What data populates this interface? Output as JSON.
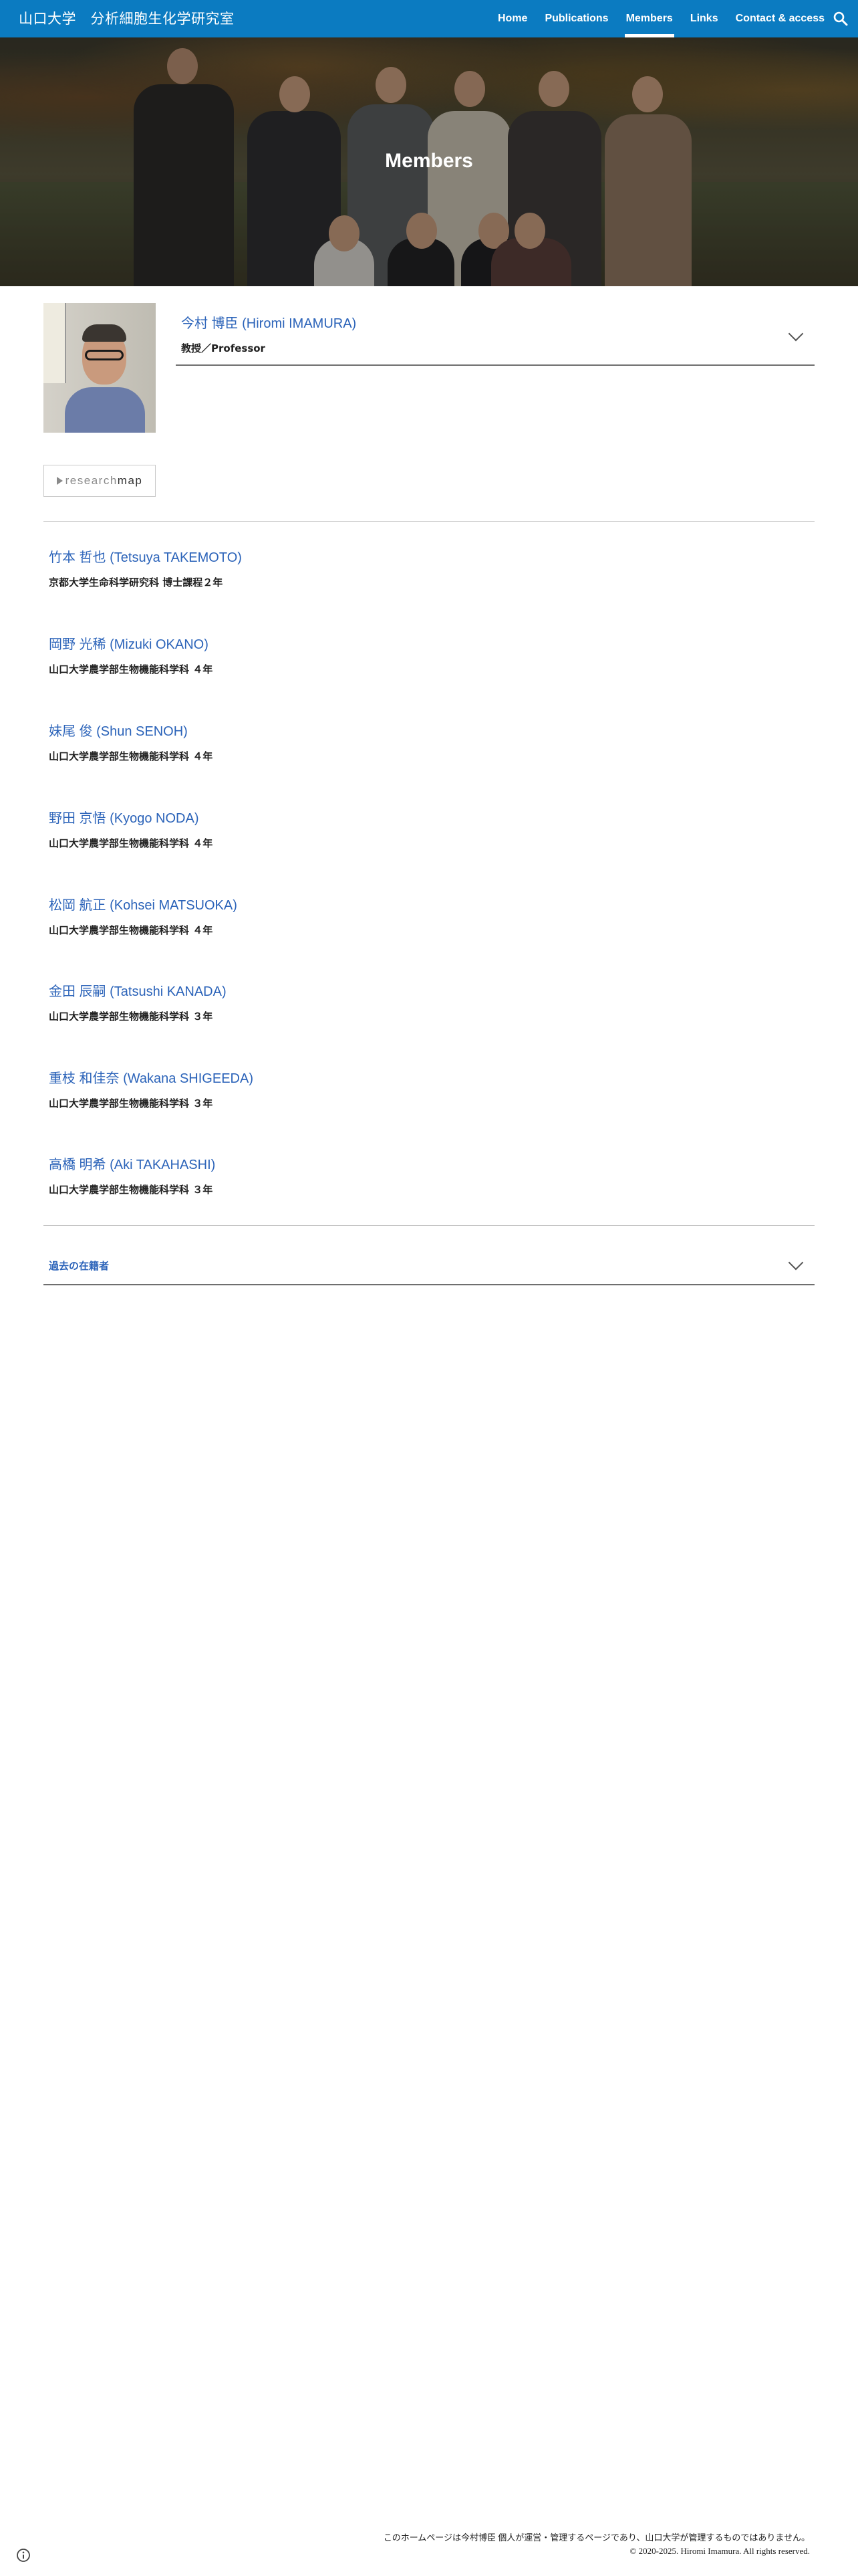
{
  "header": {
    "site_title": "山口大学　分析細胞生化学研究室",
    "nav": [
      {
        "label": "Home",
        "active": false
      },
      {
        "label": "Publications",
        "active": false
      },
      {
        "label": "Members",
        "active": true
      },
      {
        "label": "Links",
        "active": false
      },
      {
        "label": "Contact & access",
        "active": false
      }
    ],
    "search_icon": "search-icon"
  },
  "hero": {
    "title": "Members"
  },
  "professor": {
    "name": "今村 博臣 (Hiromi IMAMURA)",
    "title": "教授／Professor",
    "expand_icon": "chevron-down-icon"
  },
  "researchmap": {
    "prefix": "research",
    "suffix": "map"
  },
  "members": [
    {
      "name": "竹本 哲也 (Tetsuya TAKEMOTO)",
      "affiliation": "京都大学生命科学研究科 博士課程２年"
    },
    {
      "name": "岡野 光稀 (Mizuki OKANO)",
      "affiliation": "山口大学農学部生物機能科学科 ４年"
    },
    {
      "name": "妹尾 俊 (Shun SENOH)",
      "affiliation": "山口大学農学部生物機能科学科 ４年"
    },
    {
      "name": "野田 京悟 (Kyogo NODA)",
      "affiliation": "山口大学農学部生物機能科学科 ４年"
    },
    {
      "name": "松岡 航正 (Kohsei MATSUOKA)",
      "affiliation": "山口大学農学部生物機能科学科 ４年"
    },
    {
      "name": "金田 辰嗣 (Tatsushi KANADA)",
      "affiliation": "山口大学農学部生物機能科学科 ３年"
    },
    {
      "name": "重枝 和佳奈 (Wakana SHIGEEDA)",
      "affiliation": "山口大学農学部生物機能科学科 ３年"
    },
    {
      "name": "高橋 明希 (Aki TAKAHASHI)",
      "affiliation": "山口大学農学部生物機能科学科 ３年"
    }
  ],
  "past_members": {
    "label": "過去の在籍者",
    "expand_icon": "chevron-down-icon"
  },
  "footer": {
    "line1": "このホームページは今村博臣 個人が運営・管理するページであり、山口大学が管理するものではありません。",
    "line2": "© 2020-2025. Hiromi Imamura. All rights reserved.",
    "info_icon": "info-icon"
  },
  "colors": {
    "nav_bar": "#0b7bc1",
    "link_blue": "#2b63b9",
    "text": "#212121"
  }
}
